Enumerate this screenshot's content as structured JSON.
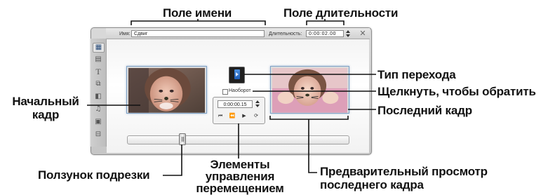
{
  "annotations": {
    "name_field": "Поле имени",
    "duration_field": "Поле длительности",
    "transition_type": "Тип перехода",
    "click_to_reverse": "Щелкнуть, чтобы обратить",
    "last_frame": "Последний кадр",
    "start_frame_line1": "Начальный",
    "start_frame_line2": "кадр",
    "trim_slider": "Ползунок подрезки",
    "nav_line1": "Элементы",
    "nav_line2": "управления",
    "nav_line3": "перемещением",
    "preview_line1": "Предварительный просмотр",
    "preview_line2": "последнего кадра"
  },
  "editor": {
    "name_label": "Имя:",
    "name_value": "Сдвиг",
    "duration_label": "Длительность:",
    "duration_value": "0:00:02.00",
    "reverse_label": "Наоборот",
    "timecode": "0:00:00.15",
    "close_glyph": "✕",
    "side_tools": [
      {
        "icon": "transition-tool-icon",
        "glyph": "▦"
      },
      {
        "icon": "video-tool-icon",
        "glyph": "▤"
      },
      {
        "icon": "title-tool-icon",
        "glyph": "T"
      },
      {
        "icon": "photo-tool-icon",
        "glyph": "⧉"
      },
      {
        "icon": "capture-tool-icon",
        "glyph": "◧"
      },
      {
        "icon": "music-tool-icon",
        "glyph": "♫"
      },
      {
        "icon": "effects-tool-icon",
        "glyph": "▣"
      },
      {
        "icon": "audio-tool-icon",
        "glyph": "⊟"
      }
    ],
    "player_buttons": [
      {
        "icon": "go-to-start-icon",
        "glyph": "⏮"
      },
      {
        "icon": "step-back-icon",
        "glyph": "⏪"
      },
      {
        "icon": "play-icon",
        "glyph": "▶"
      },
      {
        "icon": "loop-icon",
        "glyph": "⟳"
      }
    ]
  },
  "colors": {
    "frame_border": "#7fa3c8",
    "transition_icon": "#2f73c8"
  }
}
